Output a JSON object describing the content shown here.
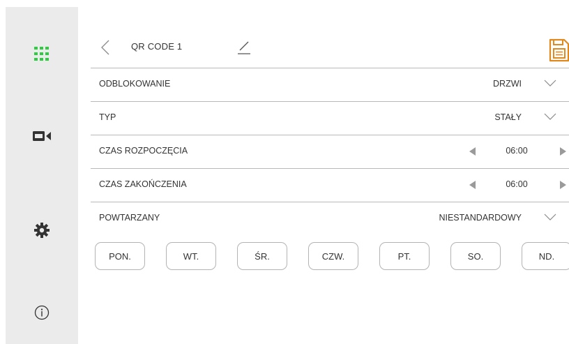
{
  "header": {
    "title": "QR CODE 1",
    "accent_color": "#e08a1e"
  },
  "sidebar": {
    "items": [
      {
        "icon": "grid-icon",
        "color": "#2ecc40"
      },
      {
        "icon": "camera-icon",
        "color": "#333333"
      },
      {
        "icon": "gear-icon",
        "color": "#333333"
      },
      {
        "icon": "info-icon",
        "color": "#333333"
      }
    ]
  },
  "settings": {
    "unlock": {
      "label": "ODBLOKOWANIE",
      "value": "DRZWI"
    },
    "type": {
      "label": "TYP",
      "value": "STAŁY"
    },
    "start_time": {
      "label": "CZAS ROZPOCZĘCIA",
      "value": "06:00"
    },
    "end_time": {
      "label": "CZAS ZAKOŃCZENIA",
      "value": "06:00"
    },
    "repeat": {
      "label": "POWTARZANY",
      "value": "NIESTANDARDOWY"
    }
  },
  "days": [
    "PON.",
    "WT.",
    "ŚR.",
    "CZW.",
    "PT.",
    "SO.",
    "ND."
  ]
}
